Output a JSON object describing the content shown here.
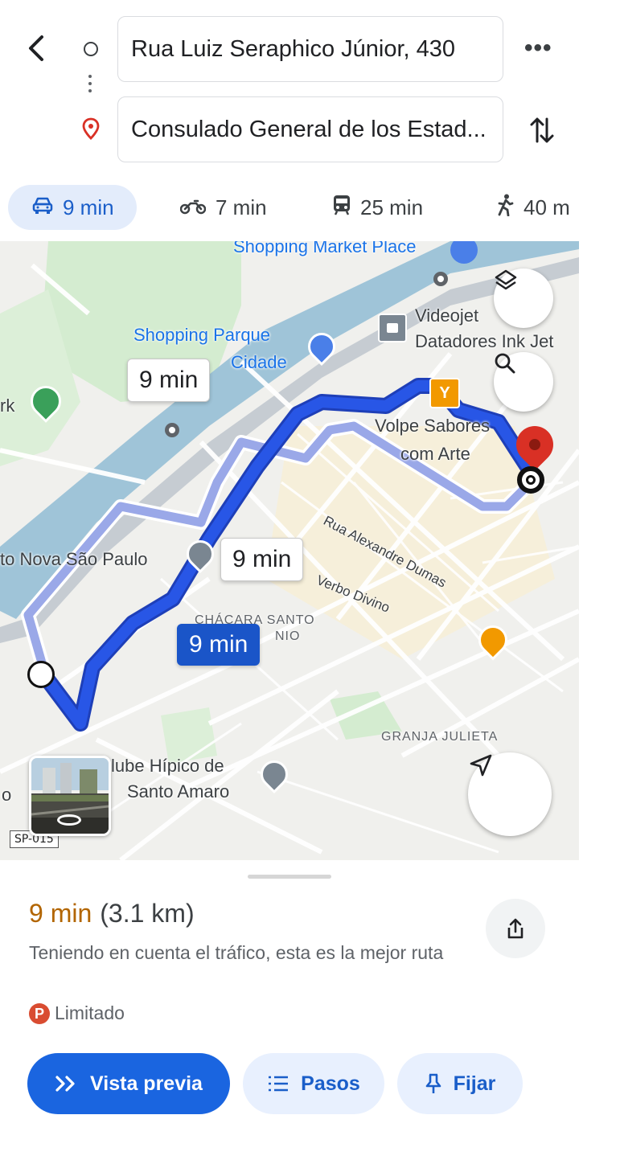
{
  "header": {
    "origin": "Rua Luiz Seraphico Júnior, 430",
    "destination": "Consulado General de los Estad...",
    "more_label": "•••"
  },
  "modes": [
    {
      "name": "car",
      "time": "9 min",
      "selected": true
    },
    {
      "name": "motorcycle",
      "time": "7 min",
      "selected": false
    },
    {
      "name": "transit",
      "time": "25 min",
      "selected": false
    },
    {
      "name": "walk",
      "time": "40 m",
      "selected": false
    }
  ],
  "map": {
    "places": {
      "shopping_market": "Shopping Market Place",
      "shopping_parque_1": "Shopping Parque",
      "shopping_parque_2": "Cidade",
      "videojet_1": "Videojet",
      "videojet_2": "Datadores Ink Jet",
      "volpe_1": "Volpe Sabores",
      "volpe_2": "com Arte",
      "nova_sao_paulo": "to Nova São Paulo",
      "park_frag": "rk",
      "chacara_1": "CHÁCARA SANTO",
      "chacara_2": "NIO",
      "granja": "GRANJA JULIETA",
      "clube_1": "lube Hípico de",
      "clube_2": "Santo Amaro",
      "frag_o": "o"
    },
    "streets": {
      "alexandre": "Rua Alexandre Dumas",
      "verbo": "Verbo Divino"
    },
    "highway_shield": "SP-015",
    "route_bubbles": [
      "9 min",
      "9 min",
      "9 min"
    ]
  },
  "sheet": {
    "time": "9 min",
    "distance": "(3.1 km)",
    "description": "Teniendo en cuenta el tráfico, esta es la mejor ruta",
    "parking_badge": "P",
    "parking_text": "Limitado",
    "buttons": {
      "preview": "Vista previa",
      "steps": "Pasos",
      "pin": "Fijar"
    }
  },
  "colors": {
    "route_active": "#2856e6",
    "route_alt": "#9aa8e8",
    "accent": "#1a65e0",
    "time_orange": "#b26500",
    "destination_pin": "#d93025"
  }
}
